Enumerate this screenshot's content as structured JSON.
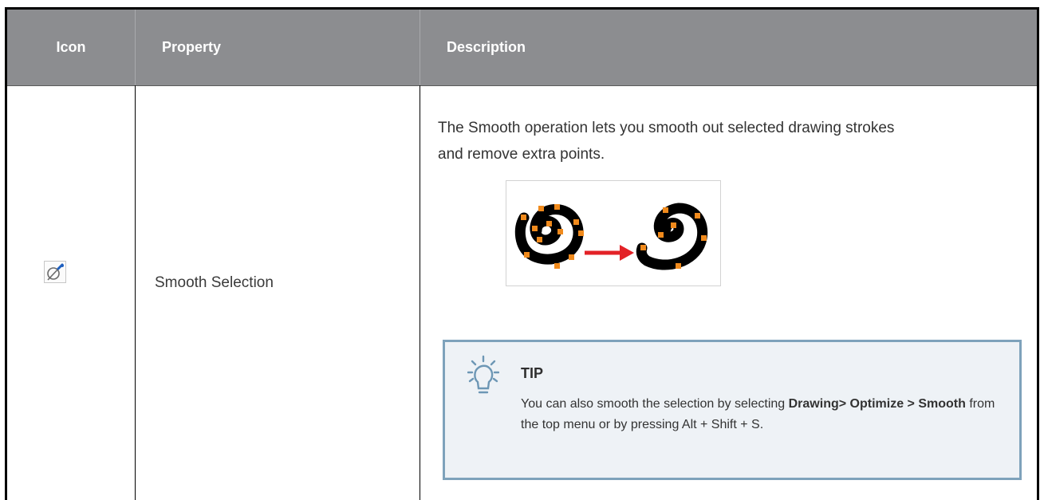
{
  "header": {
    "col_icon": "Icon",
    "col_property": "Property",
    "col_description": "Description"
  },
  "row": {
    "icon": "smooth-selection-tool-icon",
    "property": "Smooth Selection",
    "description": "The Smooth operation lets you smooth out selected drawing strokes and remove extra points.",
    "figure_icon": "smooth-before-after-illustration",
    "tip": {
      "icon": "lightbulb-icon",
      "title": "TIP",
      "text_1": "You can also smooth the selection by selecting ",
      "bold_1": "Drawing> Optimize > Smooth",
      "text_2": " from the top menu or by pressing Alt + Shift + S."
    }
  },
  "colors": {
    "header_bg": "#8c8d90",
    "tip_border": "#7ea2bb",
    "tip_bg": "#eef2f6",
    "accent_orange": "#f08a1c",
    "arrow_red": "#e32227"
  }
}
